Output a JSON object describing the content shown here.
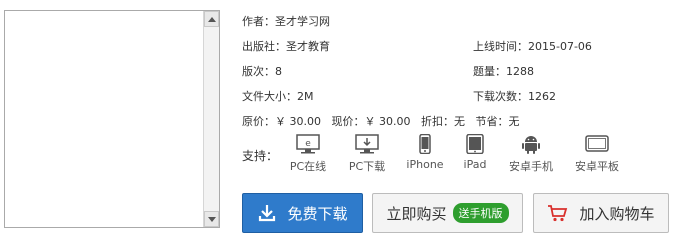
{
  "book": {
    "author_label": "作者：",
    "author": "圣才学习网",
    "publisher_label": "出版社：",
    "publisher": "圣才教育",
    "online_label": "上线时间：",
    "online": "2015-07-06",
    "edition_label": "版次：",
    "edition": "8",
    "count_label": "题量：",
    "count": "1288",
    "size_label": "文件大小：",
    "size": "2M",
    "downloads_label": "下载次数：",
    "downloads": "1262",
    "price_label": "原价：",
    "price": "￥ 30.00",
    "current_label": "现价：",
    "current": "￥ 30.00",
    "discount_label": "折扣：",
    "discount": "无",
    "save_label": "节省：",
    "save": "无"
  },
  "support": {
    "label": "支持：",
    "platforms": [
      {
        "label": "PC在线",
        "icon": "pc-online-icon"
      },
      {
        "label": "PC下载",
        "icon": "pc-download-icon"
      },
      {
        "label": "iPhone",
        "icon": "iphone-icon"
      },
      {
        "label": "iPad",
        "icon": "ipad-icon"
      },
      {
        "label": "安卓手机",
        "icon": "android-icon"
      },
      {
        "label": "安卓平板",
        "icon": "android-tablet-icon"
      }
    ]
  },
  "actions": {
    "download": "免费下载",
    "buy": "立即购买",
    "buy_badge": "送手机版",
    "cart": "加入购物车"
  },
  "colors": {
    "download_bg": "#2f7bcb",
    "badge_bg": "#2e9e2e",
    "cart_icon": "#d9302c"
  }
}
